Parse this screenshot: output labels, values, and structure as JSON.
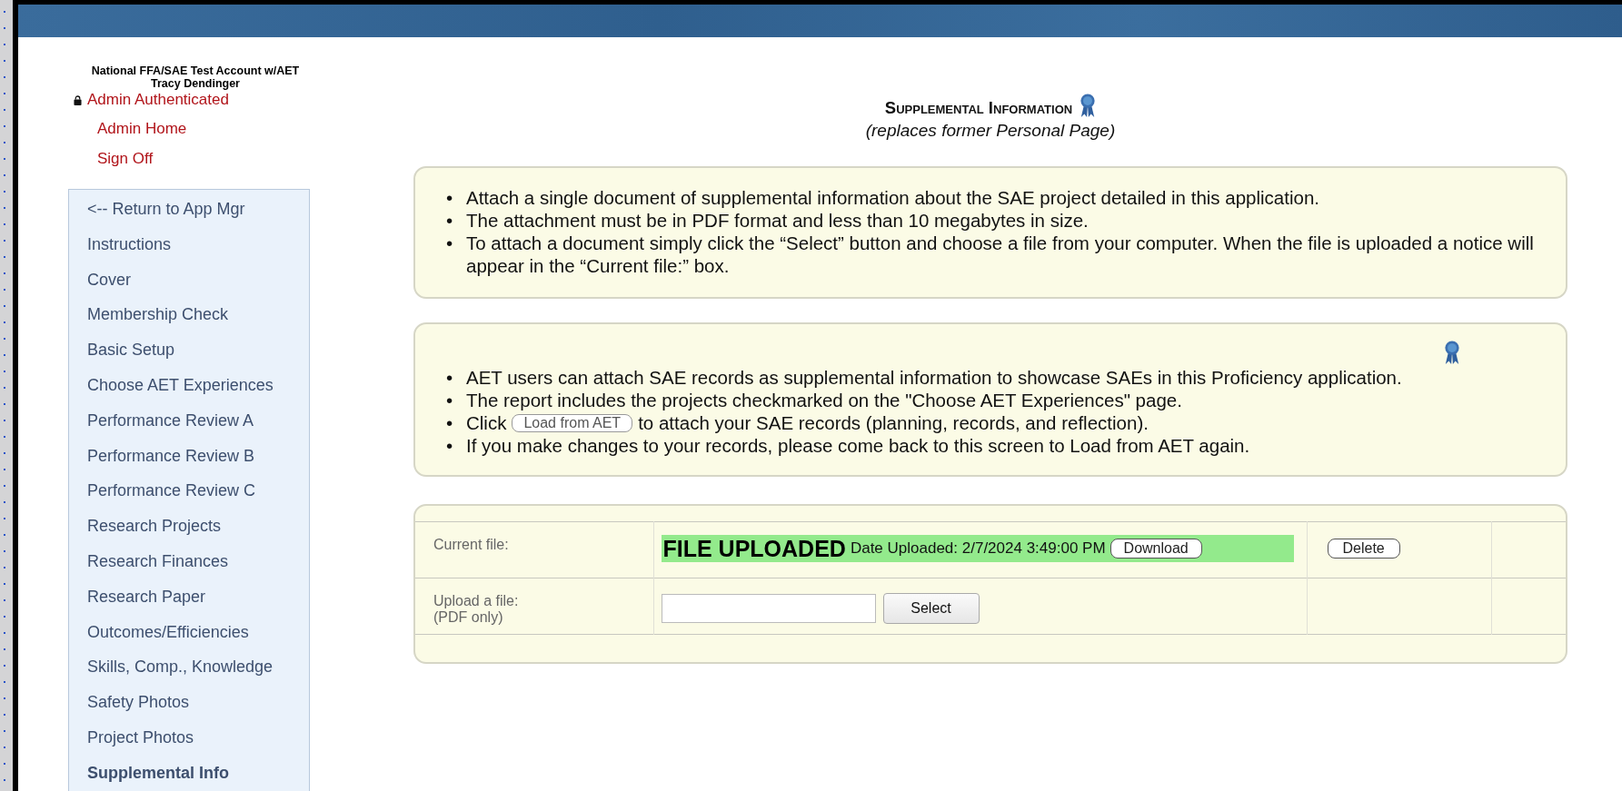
{
  "header": {
    "account": "National FFA/SAE Test Account w/AET",
    "user": "Tracy Dendinger",
    "auth_status": "Admin Authenticated",
    "links": [
      "Admin Home",
      "Sign Off"
    ]
  },
  "sidebar": {
    "items": [
      {
        "label": "<-- Return to App Mgr",
        "selected": false
      },
      {
        "label": "Instructions",
        "selected": false
      },
      {
        "label": "Cover",
        "selected": false
      },
      {
        "label": "Membership Check",
        "selected": false
      },
      {
        "label": "Basic Setup",
        "selected": false
      },
      {
        "label": "Choose AET Experiences",
        "selected": false
      },
      {
        "label": "Performance Review A",
        "selected": false
      },
      {
        "label": "Performance Review B",
        "selected": false
      },
      {
        "label": "Performance Review C",
        "selected": false
      },
      {
        "label": "Research Projects",
        "selected": false
      },
      {
        "label": "Research Finances",
        "selected": false
      },
      {
        "label": "Research Paper",
        "selected": false
      },
      {
        "label": "Outcomes/Efficiencies",
        "selected": false
      },
      {
        "label": "Skills, Comp., Knowledge",
        "selected": false
      },
      {
        "label": "Safety Photos",
        "selected": false
      },
      {
        "label": "Project Photos",
        "selected": false
      },
      {
        "label": "Supplemental Info",
        "selected": true
      }
    ]
  },
  "page": {
    "title": "Supplemental Information",
    "subtitle": "(replaces former Personal Page)"
  },
  "instructions": {
    "bullets": [
      {
        "marker": "•",
        "text": "Attach a single document of supplemental information about the SAE project detailed in this application."
      },
      {
        "marker": "•",
        "text": "The attachment must be in PDF format and less than 10 megabytes in size."
      },
      {
        "marker": "•",
        "text": "To attach a document simply click the “Select” button and choose a file from your computer. When the file is uploaded a notice will appear in the “Current file:” box."
      }
    ]
  },
  "aet_notice": {
    "bullets": [
      {
        "marker": "•",
        "text": "AET users can attach SAE records as supplemental information to showcase SAEs in this Proficiency application."
      },
      {
        "marker": "•",
        "text": "The report includes the projects checkmarked on the \"Choose AET Experiences\" page."
      },
      {
        "marker": "•",
        "before": "Click",
        "button": "Load from AET",
        "after": "to attach your SAE records (planning, records, and reflection)."
      },
      {
        "marker": "•",
        "text": "If you make changes to your records, please come back to this screen to Load from AET again."
      }
    ]
  },
  "upload": {
    "current_file": {
      "label": "Current file:",
      "status": "FILE UPLOADED",
      "date": "Date Uploaded: 2/7/2024 3:49:00 PM",
      "download": "Download",
      "delete": "Delete"
    },
    "new_file": {
      "label": "Upload a file:",
      "note": "(PDF only)",
      "select": "Select"
    }
  }
}
